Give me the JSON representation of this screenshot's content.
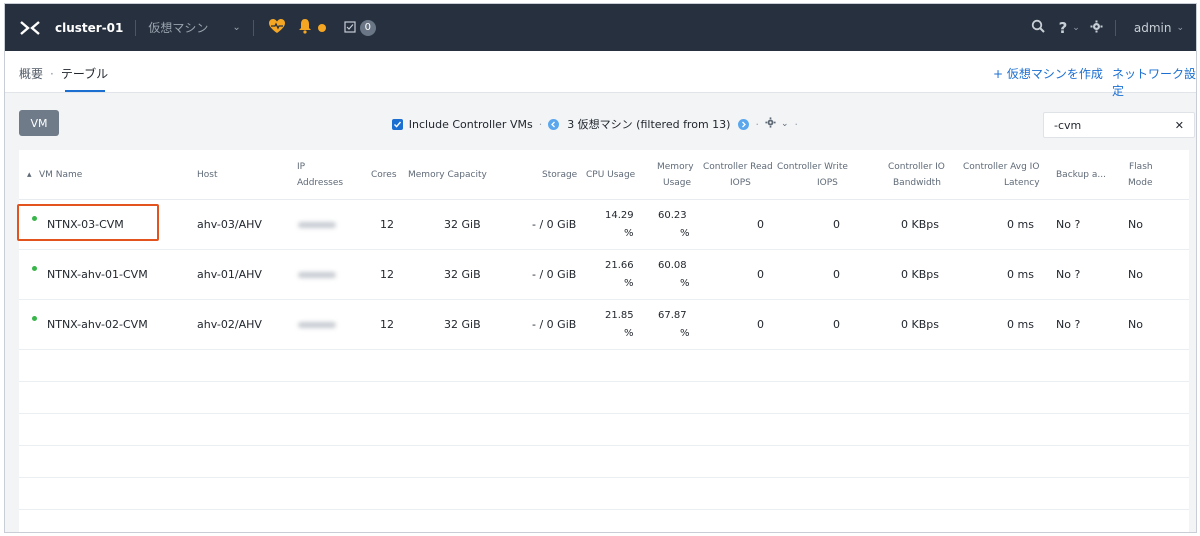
{
  "header": {
    "cluster": "cluster-01",
    "entity_menu": "仮想マシン",
    "tasks_count": "0",
    "user": "admin"
  },
  "breadcrumb": {
    "overview": "概要",
    "separator": "·",
    "table": "テーブル"
  },
  "actions": {
    "create_vm": "+ 仮想マシンを作成",
    "network_config": "ネットワーク設定"
  },
  "toolbar": {
    "vm_button": "VM",
    "include_cvms": "Include Controller VMs",
    "count_text": "3 仮想マシン (filtered from 13)",
    "search_value": "-cvm"
  },
  "table": {
    "headers": {
      "vm_name": "VM Name",
      "host": "Host",
      "ip1": "IP",
      "ip2": "Addresses",
      "cores": "Cores",
      "memory_capacity": "Memory Capacity",
      "storage": "Storage",
      "cpu_usage": "CPU Usage",
      "mem_usage1": "Memory",
      "mem_usage2": "Usage",
      "ctrl_read1": "Controller Read",
      "ctrl_read2": "IOPS",
      "ctrl_write1": "Controller Write",
      "ctrl_write2": "IOPS",
      "ctrl_io_bw1": "Controller IO",
      "ctrl_io_bw2": "Bandwidth",
      "ctrl_avg1": "Controller Avg IO",
      "ctrl_avg2": "Latency",
      "backup": "Backup a...",
      "flash1": "Flash",
      "flash2": "Mode"
    },
    "rows": [
      {
        "name": "NTNX-03-CVM",
        "host": "ahv-03/AHV",
        "ip": "172.22.1...",
        "cores": "12",
        "memory_capacity": "32 GiB",
        "storage": "- / 0 GiB",
        "cpu_value": "14.29",
        "cpu_unit": "%",
        "mem_value": "60.23",
        "mem_unit": "%",
        "ctrl_read": "0",
        "ctrl_write": "0",
        "ctrl_bw": "0 KBps",
        "ctrl_latency": "0 ms",
        "backup": "No ?",
        "flash": "No"
      },
      {
        "name": "NTNX-ahv-01-CVM",
        "host": "ahv-01/AHV",
        "ip": "172.22.1...",
        "cores": "12",
        "memory_capacity": "32 GiB",
        "storage": "- / 0 GiB",
        "cpu_value": "21.66",
        "cpu_unit": "%",
        "mem_value": "60.08",
        "mem_unit": "%",
        "ctrl_read": "0",
        "ctrl_write": "0",
        "ctrl_bw": "0 KBps",
        "ctrl_latency": "0 ms",
        "backup": "No ?",
        "flash": "No"
      },
      {
        "name": "NTNX-ahv-02-CVM",
        "host": "ahv-02/AHV",
        "ip": "172.22.1...",
        "cores": "12",
        "memory_capacity": "32 GiB",
        "storage": "- / 0 GiB",
        "cpu_value": "21.85",
        "cpu_unit": "%",
        "mem_value": "67.87",
        "mem_unit": "%",
        "ctrl_read": "0",
        "ctrl_write": "0",
        "ctrl_bw": "0 KBps",
        "ctrl_latency": "0 ms",
        "backup": "No ?",
        "flash": "No"
      }
    ]
  },
  "colors": {
    "topbar": "#26303e",
    "accent_blue": "#1b6fd1",
    "status_green": "#39b54a",
    "alert_orange": "#f5a623",
    "highlight_red": "#e2531e"
  },
  "icons": [
    "nutanix-x-icon",
    "heart-health-icon",
    "bell-icon",
    "tasks-icon",
    "search-icon",
    "help-icon",
    "gear-icon",
    "checkbox-icon",
    "pager-prev-icon",
    "pager-next-icon",
    "close-icon"
  ]
}
